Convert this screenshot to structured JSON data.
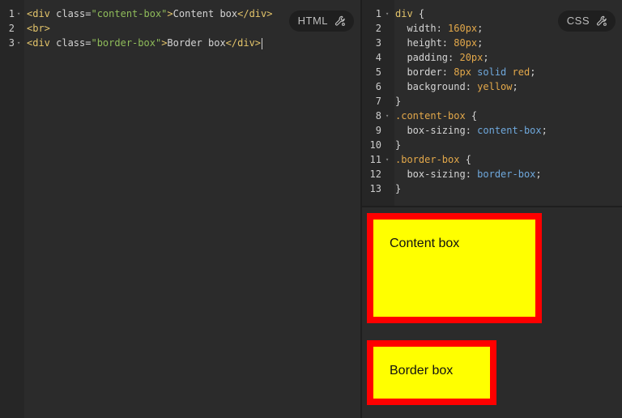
{
  "html_editor": {
    "badge_label": "HTML",
    "lines": [
      {
        "n": "1",
        "fold": true,
        "parts": [
          [
            "tag",
            "<div "
          ],
          [
            "attr",
            "class="
          ],
          [
            "str",
            "\"content-box\""
          ],
          [
            "tag",
            ">"
          ],
          [
            "txt",
            "Content box"
          ],
          [
            "tag",
            "</div>"
          ]
        ]
      },
      {
        "n": "2",
        "fold": false,
        "parts": [
          [
            "tag",
            "<br>"
          ]
        ]
      },
      {
        "n": "3",
        "fold": true,
        "parts": [
          [
            "tag",
            "<div "
          ],
          [
            "attr",
            "class="
          ],
          [
            "str",
            "\"border-box\""
          ],
          [
            "tag",
            ">"
          ],
          [
            "txt",
            "Border box"
          ],
          [
            "tag",
            "</div>"
          ]
        ],
        "cursor": true
      }
    ]
  },
  "css_editor": {
    "badge_label": "CSS",
    "lines": [
      {
        "n": "1",
        "fold": true,
        "parts": [
          [
            "kw",
            "div"
          ],
          [
            "txt",
            " {"
          ]
        ]
      },
      {
        "n": "2",
        "fold": false,
        "parts": [
          [
            "txt",
            "  "
          ],
          [
            "prop",
            "width: "
          ],
          [
            "num",
            "160px"
          ],
          [
            "txt",
            ";"
          ]
        ]
      },
      {
        "n": "3",
        "fold": false,
        "parts": [
          [
            "txt",
            "  "
          ],
          [
            "prop",
            "height: "
          ],
          [
            "num",
            "80px"
          ],
          [
            "txt",
            ";"
          ]
        ]
      },
      {
        "n": "4",
        "fold": false,
        "parts": [
          [
            "txt",
            "  "
          ],
          [
            "prop",
            "padding: "
          ],
          [
            "num",
            "20px"
          ],
          [
            "txt",
            ";"
          ]
        ]
      },
      {
        "n": "5",
        "fold": false,
        "parts": [
          [
            "txt",
            "  "
          ],
          [
            "prop",
            "border: "
          ],
          [
            "num",
            "8px "
          ],
          [
            "val",
            "solid "
          ],
          [
            "red",
            "red"
          ],
          [
            "txt",
            ";"
          ]
        ]
      },
      {
        "n": "6",
        "fold": false,
        "parts": [
          [
            "txt",
            "  "
          ],
          [
            "prop",
            "background: "
          ],
          [
            "red",
            "yellow"
          ],
          [
            "txt",
            ";"
          ]
        ]
      },
      {
        "n": "7",
        "fold": false,
        "parts": [
          [
            "txt",
            "}"
          ]
        ]
      },
      {
        "n": "8",
        "fold": true,
        "parts": [
          [
            "sel",
            ".content-box"
          ],
          [
            "txt",
            " {"
          ]
        ]
      },
      {
        "n": "9",
        "fold": false,
        "parts": [
          [
            "txt",
            "  "
          ],
          [
            "prop",
            "box-sizing: "
          ],
          [
            "val",
            "content-box"
          ],
          [
            "txt",
            ";"
          ]
        ]
      },
      {
        "n": "10",
        "fold": false,
        "parts": [
          [
            "txt",
            "}"
          ]
        ]
      },
      {
        "n": "11",
        "fold": true,
        "parts": [
          [
            "sel",
            ".border-box"
          ],
          [
            "txt",
            " {"
          ]
        ]
      },
      {
        "n": "12",
        "fold": false,
        "parts": [
          [
            "txt",
            "  "
          ],
          [
            "prop",
            "box-sizing: "
          ],
          [
            "val",
            "border-box"
          ],
          [
            "txt",
            ";"
          ]
        ]
      },
      {
        "n": "13",
        "fold": false,
        "parts": [
          [
            "txt",
            "}"
          ]
        ]
      }
    ]
  },
  "preview": {
    "content_box_text": "Content box",
    "border_box_text": "Border box"
  },
  "icons": {
    "badge_icon": "wrench-settings-icon",
    "fold_icon": "fold-arrow-icon"
  },
  "colors": {
    "box_background": "#ffff00",
    "box_border": "#ff0000",
    "editor_background": "#2b2b2b"
  }
}
